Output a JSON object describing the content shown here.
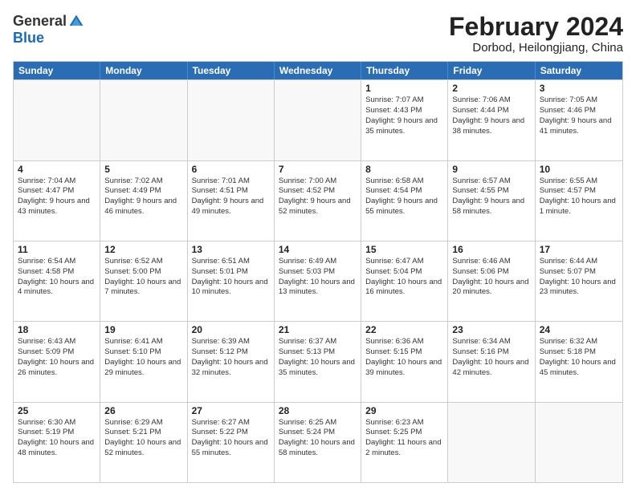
{
  "logo": {
    "general": "General",
    "blue": "Blue"
  },
  "title": "February 2024",
  "location": "Dorbod, Heilongjiang, China",
  "weekdays": [
    "Sunday",
    "Monday",
    "Tuesday",
    "Wednesday",
    "Thursday",
    "Friday",
    "Saturday"
  ],
  "rows": [
    [
      {
        "day": "",
        "empty": true
      },
      {
        "day": "",
        "empty": true
      },
      {
        "day": "",
        "empty": true
      },
      {
        "day": "",
        "empty": true
      },
      {
        "day": "1",
        "sunrise": "7:07 AM",
        "sunset": "4:43 PM",
        "daylight": "9 hours and 35 minutes."
      },
      {
        "day": "2",
        "sunrise": "7:06 AM",
        "sunset": "4:44 PM",
        "daylight": "9 hours and 38 minutes."
      },
      {
        "day": "3",
        "sunrise": "7:05 AM",
        "sunset": "4:46 PM",
        "daylight": "9 hours and 41 minutes."
      }
    ],
    [
      {
        "day": "4",
        "sunrise": "7:04 AM",
        "sunset": "4:47 PM",
        "daylight": "9 hours and 43 minutes."
      },
      {
        "day": "5",
        "sunrise": "7:02 AM",
        "sunset": "4:49 PM",
        "daylight": "9 hours and 46 minutes."
      },
      {
        "day": "6",
        "sunrise": "7:01 AM",
        "sunset": "4:51 PM",
        "daylight": "9 hours and 49 minutes."
      },
      {
        "day": "7",
        "sunrise": "7:00 AM",
        "sunset": "4:52 PM",
        "daylight": "9 hours and 52 minutes."
      },
      {
        "day": "8",
        "sunrise": "6:58 AM",
        "sunset": "4:54 PM",
        "daylight": "9 hours and 55 minutes."
      },
      {
        "day": "9",
        "sunrise": "6:57 AM",
        "sunset": "4:55 PM",
        "daylight": "9 hours and 58 minutes."
      },
      {
        "day": "10",
        "sunrise": "6:55 AM",
        "sunset": "4:57 PM",
        "daylight": "10 hours and 1 minute."
      }
    ],
    [
      {
        "day": "11",
        "sunrise": "6:54 AM",
        "sunset": "4:58 PM",
        "daylight": "10 hours and 4 minutes."
      },
      {
        "day": "12",
        "sunrise": "6:52 AM",
        "sunset": "5:00 PM",
        "daylight": "10 hours and 7 minutes."
      },
      {
        "day": "13",
        "sunrise": "6:51 AM",
        "sunset": "5:01 PM",
        "daylight": "10 hours and 10 minutes."
      },
      {
        "day": "14",
        "sunrise": "6:49 AM",
        "sunset": "5:03 PM",
        "daylight": "10 hours and 13 minutes."
      },
      {
        "day": "15",
        "sunrise": "6:47 AM",
        "sunset": "5:04 PM",
        "daylight": "10 hours and 16 minutes."
      },
      {
        "day": "16",
        "sunrise": "6:46 AM",
        "sunset": "5:06 PM",
        "daylight": "10 hours and 20 minutes."
      },
      {
        "day": "17",
        "sunrise": "6:44 AM",
        "sunset": "5:07 PM",
        "daylight": "10 hours and 23 minutes."
      }
    ],
    [
      {
        "day": "18",
        "sunrise": "6:43 AM",
        "sunset": "5:09 PM",
        "daylight": "10 hours and 26 minutes."
      },
      {
        "day": "19",
        "sunrise": "6:41 AM",
        "sunset": "5:10 PM",
        "daylight": "10 hours and 29 minutes."
      },
      {
        "day": "20",
        "sunrise": "6:39 AM",
        "sunset": "5:12 PM",
        "daylight": "10 hours and 32 minutes."
      },
      {
        "day": "21",
        "sunrise": "6:37 AM",
        "sunset": "5:13 PM",
        "daylight": "10 hours and 35 minutes."
      },
      {
        "day": "22",
        "sunrise": "6:36 AM",
        "sunset": "5:15 PM",
        "daylight": "10 hours and 39 minutes."
      },
      {
        "day": "23",
        "sunrise": "6:34 AM",
        "sunset": "5:16 PM",
        "daylight": "10 hours and 42 minutes."
      },
      {
        "day": "24",
        "sunrise": "6:32 AM",
        "sunset": "5:18 PM",
        "daylight": "10 hours and 45 minutes."
      }
    ],
    [
      {
        "day": "25",
        "sunrise": "6:30 AM",
        "sunset": "5:19 PM",
        "daylight": "10 hours and 48 minutes."
      },
      {
        "day": "26",
        "sunrise": "6:29 AM",
        "sunset": "5:21 PM",
        "daylight": "10 hours and 52 minutes."
      },
      {
        "day": "27",
        "sunrise": "6:27 AM",
        "sunset": "5:22 PM",
        "daylight": "10 hours and 55 minutes."
      },
      {
        "day": "28",
        "sunrise": "6:25 AM",
        "sunset": "5:24 PM",
        "daylight": "10 hours and 58 minutes."
      },
      {
        "day": "29",
        "sunrise": "6:23 AM",
        "sunset": "5:25 PM",
        "daylight": "11 hours and 2 minutes."
      },
      {
        "day": "",
        "empty": true
      },
      {
        "day": "",
        "empty": true
      }
    ]
  ]
}
